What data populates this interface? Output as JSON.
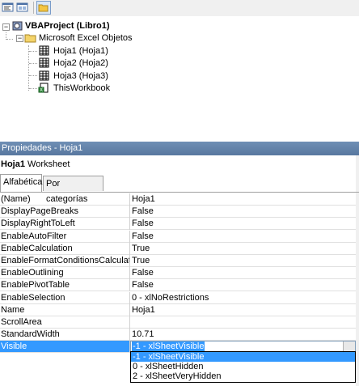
{
  "explorer": {
    "toolbar": {
      "view_code": "view-code-icon",
      "view_object": "view-object-icon",
      "toggle_folders": "folder-icon"
    },
    "tree": {
      "project": "VBAProject (Libro1)",
      "folder": "Microsoft Excel Objetos",
      "items": [
        "Hoja1 (Hoja1)",
        "Hoja2 (Hoja2)",
        "Hoja3 (Hoja3)",
        "ThisWorkbook"
      ]
    }
  },
  "properties": {
    "title": "Propiedades - Hoja1",
    "object_name": "Hoja1",
    "object_type": "Worksheet",
    "tabs": [
      "Alfabética",
      "Por categorías"
    ],
    "rows": [
      {
        "name": "(Name)",
        "value": "Hoja1"
      },
      {
        "name": "DisplayPageBreaks",
        "value": "False"
      },
      {
        "name": "DisplayRightToLeft",
        "value": "False"
      },
      {
        "name": "EnableAutoFilter",
        "value": "False"
      },
      {
        "name": "EnableCalculation",
        "value": "True"
      },
      {
        "name": "EnableFormatConditionsCalculation",
        "value": "True"
      },
      {
        "name": "EnableOutlining",
        "value": "False"
      },
      {
        "name": "EnablePivotTable",
        "value": "False"
      },
      {
        "name": "EnableSelection",
        "value": "0 - xlNoRestrictions"
      },
      {
        "name": "Name",
        "value": "Hoja1"
      },
      {
        "name": "ScrollArea",
        "value": ""
      },
      {
        "name": "StandardWidth",
        "value": "10.71"
      },
      {
        "name": "Visible",
        "value": "-1 - xlSheetVisible"
      }
    ],
    "dropdown_options": [
      "-1 - xlSheetVisible",
      "0 - xlSheetHidden",
      "2 - xlSheetVeryHidden"
    ],
    "selection_color": "#3399ff"
  }
}
